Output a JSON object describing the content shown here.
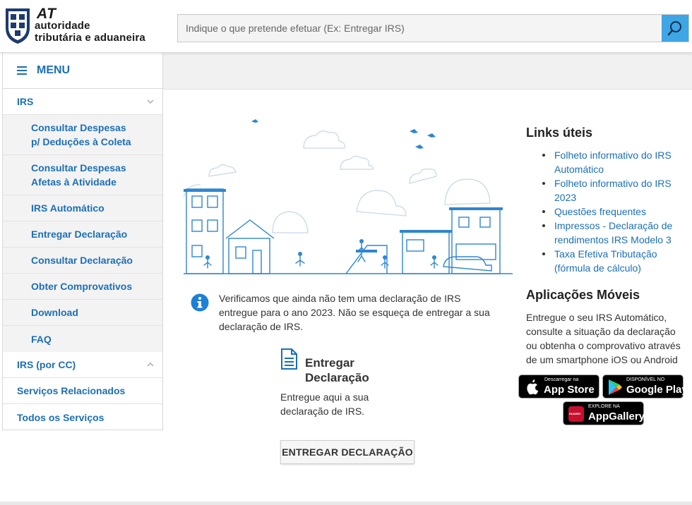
{
  "brand": {
    "abbr": "AT",
    "line1": "autoridade",
    "line2": "tributária e aduaneira"
  },
  "search": {
    "placeholder": "Indique o que pretende efetuar (Ex: Entregar IRS)",
    "value": ""
  },
  "menu": {
    "label": "MENU",
    "items": [
      {
        "label": "IRS",
        "expanded": true
      },
      {
        "label": "Consultar Despesas p/ Deduções à Coleta"
      },
      {
        "label": "Consultar Despesas Afetas à Atividade"
      },
      {
        "label": "IRS Automático"
      },
      {
        "label": "Entregar Declaração"
      },
      {
        "label": "Consultar Declaração"
      },
      {
        "label": "Obter Comprovativos"
      },
      {
        "label": "Download"
      },
      {
        "label": "FAQ"
      },
      {
        "label": "IRS (por CC)",
        "expanded": false
      },
      {
        "label": "Serviços Relacionados"
      },
      {
        "label": "Todos os Serviços"
      }
    ]
  },
  "info": {
    "text": "Verificamos que ainda não tem uma declaração de IRS entregue para o ano 2023. Não se esqueça de entregar a sua declaração de IRS."
  },
  "card": {
    "title": "Entregar Declaração",
    "description": "Entregue aqui a sua declaração de IRS.",
    "button": "ENTREGAR DECLARAÇÃO"
  },
  "links": {
    "title": "Links úteis",
    "items": [
      "Folheto informativo do IRS Automático",
      "Folheto informativo do IRS 2023",
      "Questões frequentes",
      "Impressos - Declaração de rendimentos IRS Modelo 3",
      "Taxa Efetiva Tributação (fórmula de cálculo)"
    ]
  },
  "apps": {
    "title": "Aplicações Móveis",
    "text": "Entregue o seu IRS Automático, consulte a situação da declaração ou obtenha o comprovativo através de um smartphone iOS ou Android",
    "appstore": {
      "small": "Descarregar na",
      "big": "App Store"
    },
    "googleplay": {
      "small": "DISPONÍVEL NO",
      "big": "Google Play"
    },
    "appgallery": {
      "small": "EXPLORE NA",
      "big": "AppGallery",
      "logo": "HUAWEI"
    }
  },
  "colors": {
    "accent": "#1c6fb5",
    "search_button": "#3ea6e4"
  }
}
